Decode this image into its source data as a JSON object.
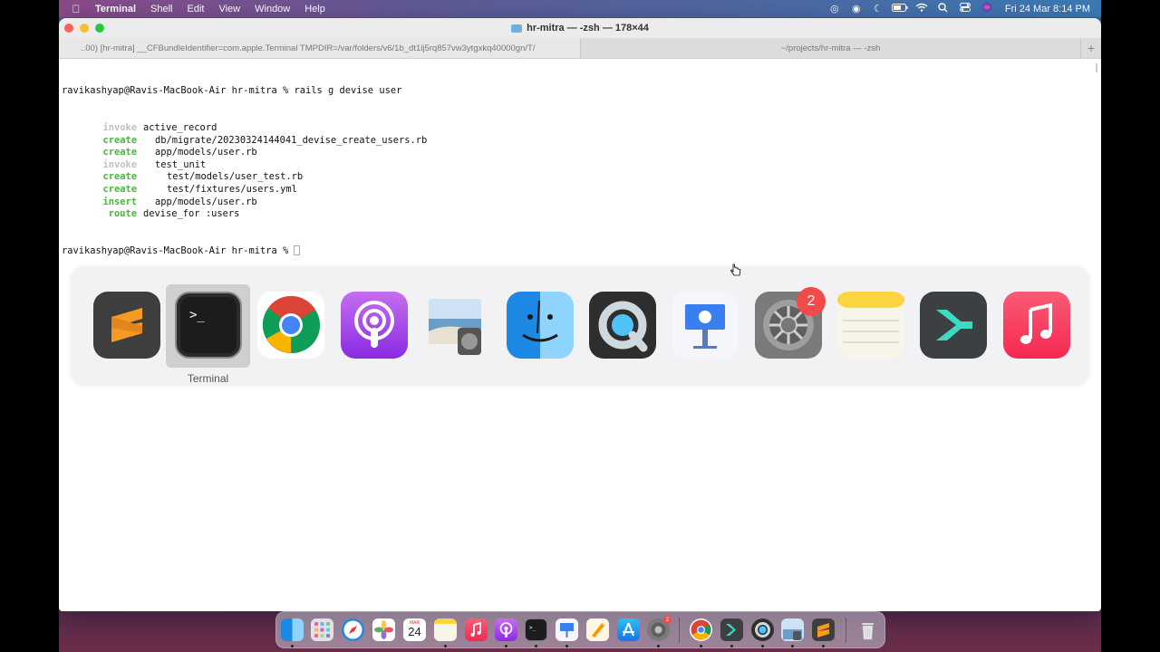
{
  "menubar": {
    "app_name": "Terminal",
    "menus": [
      "Shell",
      "Edit",
      "View",
      "Window",
      "Help"
    ],
    "status_icons": [
      "record-icon",
      "focus-icon",
      "moon-icon",
      "battery-icon",
      "wifi-icon",
      "search-icon",
      "control-center-icon",
      "siri-icon"
    ],
    "clock": "Fri 24 Mar  8:14 PM"
  },
  "window": {
    "title": "hr-mitra — -zsh — 178×44",
    "tabs": [
      {
        "label": "..00) [hr-mitra] __CFBundleIdentifier=com.apple.Terminal TMPDIR=/var/folders/v6/1b_dt1lj5rq857vw3ytgxkq40000gn/T/",
        "active": true
      },
      {
        "label": "~/projects/hr-mitra — -zsh",
        "active": false
      }
    ],
    "new_tab": "+"
  },
  "terminal": {
    "prompt_line": "ravikashyap@Ravis-MacBook-Air hr-mitra % rails g devise user",
    "output": [
      {
        "action": "invoke",
        "color": "grey",
        "indent": 1,
        "text": "active_record"
      },
      {
        "action": "create",
        "color": "green",
        "indent": 2,
        "text": "db/migrate/20230324144041_devise_create_users.rb"
      },
      {
        "action": "create",
        "color": "green",
        "indent": 2,
        "text": "app/models/user.rb"
      },
      {
        "action": "invoke",
        "color": "grey",
        "indent": 2,
        "text": "test_unit"
      },
      {
        "action": "create",
        "color": "green",
        "indent": 3,
        "text": "test/models/user_test.rb"
      },
      {
        "action": "create",
        "color": "green",
        "indent": 3,
        "text": "test/fixtures/users.yml"
      },
      {
        "action": "insert",
        "color": "green",
        "indent": 2,
        "text": "app/models/user.rb"
      },
      {
        "action": "route",
        "color": "green",
        "indent": 1,
        "text": "devise_for :users"
      }
    ],
    "final_prompt": "ravikashyap@Ravis-MacBook-Air hr-mitra % "
  },
  "app_switcher": {
    "selected_label": "Terminal",
    "apps": [
      {
        "name": "Sublime Text",
        "icon": "sublime-text-icon"
      },
      {
        "name": "Terminal",
        "icon": "terminal-icon"
      },
      {
        "name": "Google Chrome",
        "icon": "chrome-icon"
      },
      {
        "name": "Podcasts",
        "icon": "podcasts-icon"
      },
      {
        "name": "Preview",
        "icon": "preview-icon"
      },
      {
        "name": "Finder",
        "icon": "finder-icon"
      },
      {
        "name": "QuickTime Player",
        "icon": "quicktime-icon"
      },
      {
        "name": "Keynote",
        "icon": "keynote-icon"
      },
      {
        "name": "System Preferences",
        "icon": "system-preferences-icon",
        "badge": "2"
      },
      {
        "name": "Notes",
        "icon": "notes-icon"
      },
      {
        "name": "Sublime Merge",
        "icon": "sublime-merge-icon"
      },
      {
        "name": "Music",
        "icon": "music-icon"
      }
    ]
  },
  "dock": {
    "calendar_month": "MAR",
    "calendar_day": "24",
    "settings_badge": "2",
    "apps": [
      "finder-icon",
      "launchpad-icon",
      "safari-icon",
      "photos-icon",
      "calendar-icon",
      "notes-icon",
      "music-icon",
      "podcasts-icon",
      "terminal-icon",
      "keynote-icon",
      "pages-icon",
      "app-store-icon",
      "system-preferences-icon",
      "chrome-icon",
      "sublime-merge-icon",
      "quicktime-icon",
      "preview-icon",
      "sublime-text-icon",
      "trash-icon"
    ]
  }
}
